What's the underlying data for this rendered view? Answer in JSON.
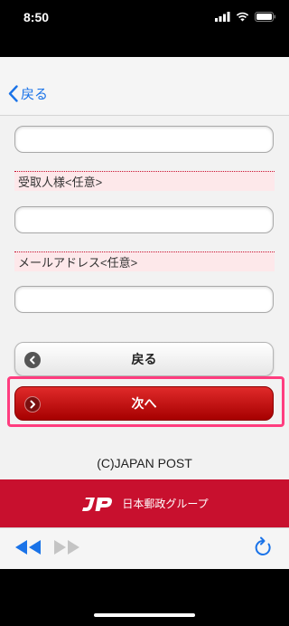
{
  "status": {
    "time": "8:50"
  },
  "nav": {
    "back_label": "戻る"
  },
  "form": {
    "input1_value": "",
    "recipient_label": "受取人様<任意>",
    "recipient_value": "",
    "email_label": "メールアドレス<任意>",
    "email_value": ""
  },
  "buttons": {
    "back_label": "戻る",
    "next_label": "次へ"
  },
  "footer": {
    "copyright": "(C)JAPAN POST",
    "brand_text": "日本郵政グループ"
  },
  "colors": {
    "brand_red": "#c8102e",
    "link_blue": "#1a73e8",
    "highlight_pink": "#ff3d7f"
  },
  "icons": [
    "signal-icon",
    "wifi-icon",
    "battery-icon",
    "chevron-left-icon",
    "circle-arrow-left-icon",
    "circle-arrow-right-icon",
    "jp-logo-icon",
    "rewind-icon",
    "fast-forward-icon",
    "reload-icon"
  ]
}
